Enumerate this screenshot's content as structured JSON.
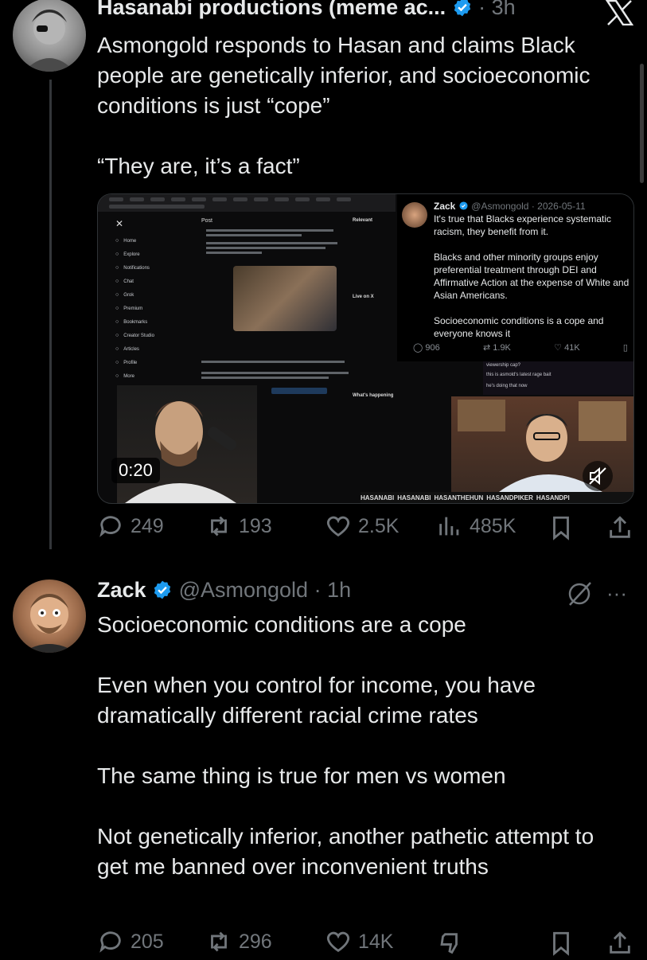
{
  "tweet1": {
    "author_name": "Hasanabi productions (meme ac...",
    "timestamp": "· 3h",
    "text": "Asmongold responds to Hasan and claims Black people are genetically inferior, and socioeconomic conditions is just “cope”\n\n“They are, it’s a fact”",
    "video_duration": "0:20",
    "actions": {
      "replies": "249",
      "reposts": "193",
      "likes": "2.5K",
      "views": "485K"
    }
  },
  "embedded_video": {
    "left_nav": [
      "Home",
      "Explore",
      "Notifications",
      "Chat",
      "Grok",
      "Premium",
      "Bookmarks",
      "Creator Studio",
      "Articles",
      "Profile",
      "More"
    ],
    "post_header": "Post",
    "relevant_label": "Relevant",
    "live_label": "Live on X",
    "whats_happening": "What's happening",
    "quoted": {
      "name": "Zack",
      "handle_time": "@Asmongold · 2026-05-11",
      "text": "It's true that Blacks experience systematic racism, they benefit from it.\n\nBlacks and other minority groups enjoy preferential treatment through DEI and Affirmative Action at the expense of White and Asian Americans.\n\nSocioeconomic conditions is a cope and everyone knows it",
      "replies": "906",
      "reposts": "1.9K",
      "likes": "41K"
    },
    "chat_lines": [
      "viewership cap?",
      "this is asmold's latest rage bait",
      "he's doing that now"
    ],
    "stream_bar": [
      "HASANABI",
      "HASANABI",
      "HASANTHEHUN",
      "HASANDPIKER",
      "HASANDPI"
    ]
  },
  "tweet2": {
    "author_name": "Zack",
    "handle_time": "@Asmongold · 1h",
    "text": "Socioeconomic conditions are a cope\n\nEven when you control for income, you have dramatically different racial crime rates\n\nThe same thing is true for men vs women\n\nNot genetically inferior, another pathetic attempt to get me banned over inconvenient truths",
    "actions": {
      "replies": "205",
      "reposts": "296",
      "likes": "14K"
    }
  },
  "icons": {
    "verified": "verified-badge-icon",
    "close": "x-close-icon",
    "reply": "reply-icon",
    "repost": "repost-icon",
    "like": "heart-icon",
    "views": "views-icon",
    "bookmark": "bookmark-icon",
    "share": "share-icon",
    "grok": "grok-icon",
    "more": "more-icon",
    "dislike": "dislike-icon"
  },
  "colors": {
    "background": "#000000",
    "text": "#e7e9ea",
    "muted": "#71767b",
    "verified": "#1d9bf0",
    "divider": "#333639"
  }
}
